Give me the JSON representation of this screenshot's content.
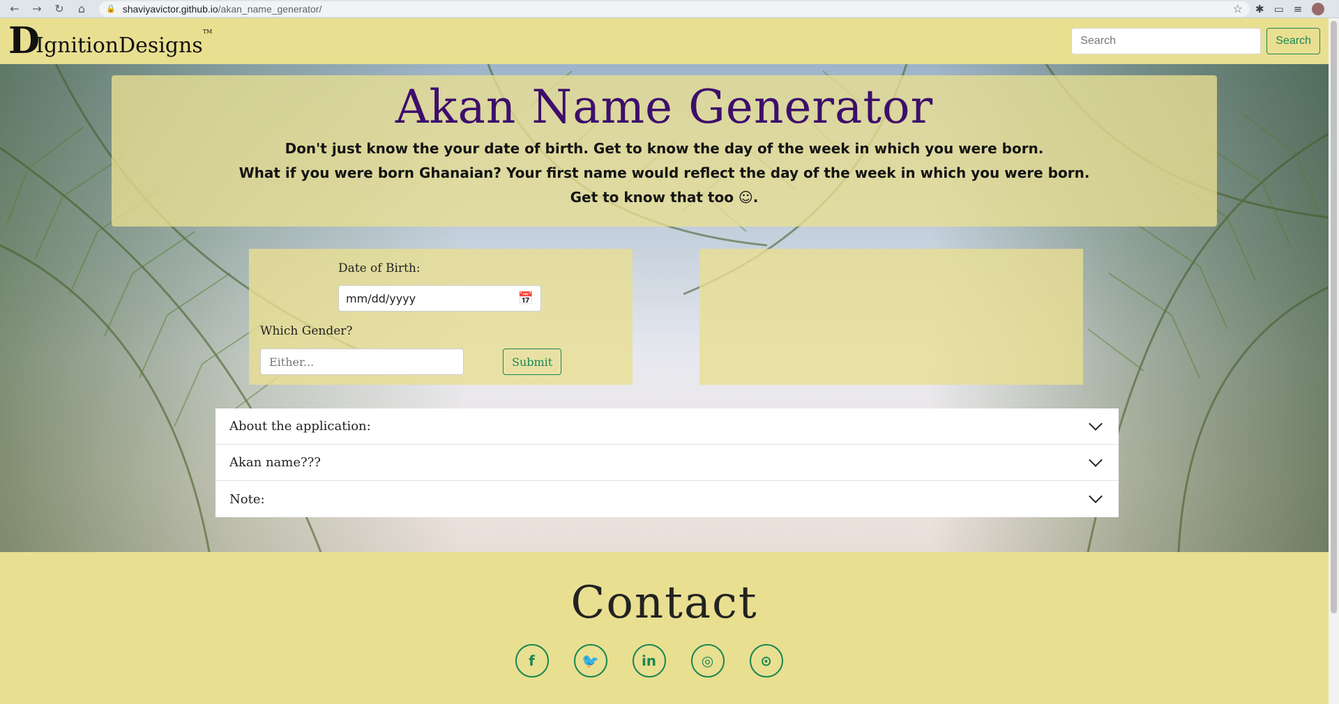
{
  "browser": {
    "url_host": "shaviyavictor.github.io",
    "url_path": "/akan_name_generator/"
  },
  "navbar": {
    "logo_initial": "D",
    "logo_text": "IgnitionDesigns",
    "logo_tm": "TM",
    "search_placeholder": "Search",
    "search_button": "Search"
  },
  "header": {
    "title": "Akan Name Generator",
    "lines": [
      "Don't just know the your date of birth. Get to know the day of the week in which you were born.",
      "What if you were born Ghanaian? Your first name would reflect the day of the week in which you were born.",
      "Get to know that too ☺."
    ]
  },
  "form": {
    "dob_label": "Date of Birth:",
    "dob_value": "mm/dd/yyyy",
    "gender_label": "Which Gender?",
    "gender_placeholder": "Either...",
    "submit_label": "Submit"
  },
  "accordion": [
    {
      "label": "About the application:"
    },
    {
      "label": "Akan name???"
    },
    {
      "label": "Note:"
    }
  ],
  "contact": {
    "title": "Contact",
    "socials": [
      {
        "icon": "facebook-icon",
        "glyph": "f"
      },
      {
        "icon": "twitter-icon",
        "glyph": "🐦"
      },
      {
        "icon": "linkedin-icon",
        "glyph": "in"
      },
      {
        "icon": "instagram-icon",
        "glyph": "◎"
      },
      {
        "icon": "github-icon",
        "glyph": "⊙"
      }
    ]
  },
  "colors": {
    "brand_yellow": "#e9df91",
    "title_purple": "#3d0e6b",
    "accent_green": "#198754"
  }
}
